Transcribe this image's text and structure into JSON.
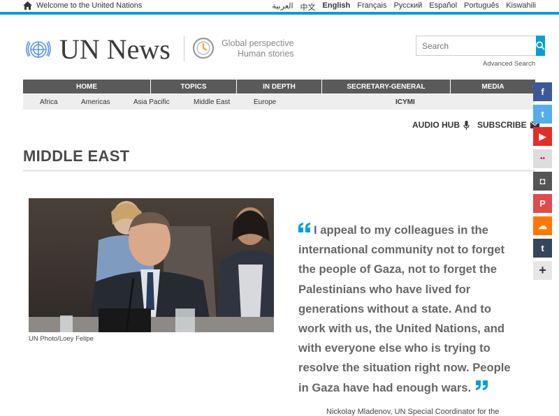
{
  "topbar": {
    "welcome": "Welcome to the United Nations",
    "languages": [
      "العربية",
      "中文",
      "English",
      "Français",
      "Русский",
      "Español",
      "Português",
      "Kiswahili"
    ],
    "active_language": "English"
  },
  "header": {
    "logo_text": "UN News",
    "tagline_line1": "Global perspective",
    "tagline_line2": "Human stories",
    "search_placeholder": "Search",
    "advanced_search": "Advanced Search"
  },
  "mainnav": [
    "HOME",
    "TOPICS",
    "IN DEPTH",
    "SECRETARY-GENERAL",
    "MEDIA"
  ],
  "subnav": [
    "Africa",
    "Americas",
    "Asia Pacific",
    "Middle East",
    "Europe",
    "ICYMI"
  ],
  "utility": {
    "audio_hub": "AUDIO HUB",
    "subscribe": "SUBSCRIBE"
  },
  "page": {
    "title": "MIDDLE EAST",
    "photo_credit": "UN Photo/Loey Felipe",
    "quote": "I appeal to my colleagues in the international community not to forget the people of Gaza, not to forget the Palestinians who have lived for generations without a state. And to work with us, the United Nations, and with everyone else who is trying to resolve the situation right now. People in Gaza have had enough wars.",
    "quote_author": "Nickolay Mladenov, UN Special Coordinator for the"
  },
  "social": [
    {
      "name": "facebook",
      "glyph": "f",
      "color": "#3b5998"
    },
    {
      "name": "twitter",
      "glyph": "t",
      "color": "#55acee"
    },
    {
      "name": "youtube",
      "glyph": "▶",
      "color": "#e52d27"
    },
    {
      "name": "flickr",
      "glyph": "••",
      "color": "#ddd"
    },
    {
      "name": "instagram",
      "glyph": "◘",
      "color": "#555"
    },
    {
      "name": "pinterest",
      "glyph": "P",
      "color": "#e04b4b"
    },
    {
      "name": "soundcloud",
      "glyph": "☁",
      "color": "#ff7700"
    },
    {
      "name": "tumblr",
      "glyph": "t",
      "color": "#35465c"
    },
    {
      "name": "more",
      "glyph": "+",
      "color": "#e6e6e6"
    }
  ],
  "colors": {
    "accent": "#009edb",
    "nav": "#5a5a5a"
  }
}
